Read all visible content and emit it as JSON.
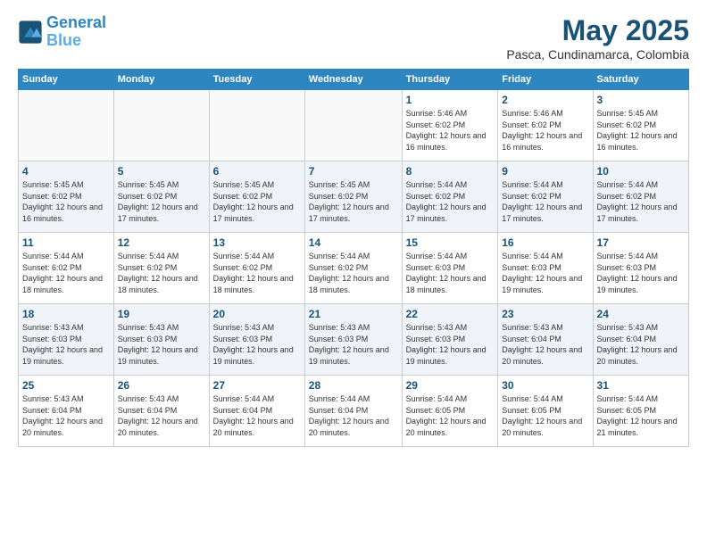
{
  "header": {
    "logo_line1": "General",
    "logo_line2": "Blue",
    "month_title": "May 2025",
    "location": "Pasca, Cundinamarca, Colombia"
  },
  "weekdays": [
    "Sunday",
    "Monday",
    "Tuesday",
    "Wednesday",
    "Thursday",
    "Friday",
    "Saturday"
  ],
  "weeks": [
    [
      {
        "day": "",
        "info": ""
      },
      {
        "day": "",
        "info": ""
      },
      {
        "day": "",
        "info": ""
      },
      {
        "day": "",
        "info": ""
      },
      {
        "day": "1",
        "info": "Sunrise: 5:46 AM\nSunset: 6:02 PM\nDaylight: 12 hours\nand 16 minutes."
      },
      {
        "day": "2",
        "info": "Sunrise: 5:46 AM\nSunset: 6:02 PM\nDaylight: 12 hours\nand 16 minutes."
      },
      {
        "day": "3",
        "info": "Sunrise: 5:45 AM\nSunset: 6:02 PM\nDaylight: 12 hours\nand 16 minutes."
      }
    ],
    [
      {
        "day": "4",
        "info": "Sunrise: 5:45 AM\nSunset: 6:02 PM\nDaylight: 12 hours\nand 16 minutes."
      },
      {
        "day": "5",
        "info": "Sunrise: 5:45 AM\nSunset: 6:02 PM\nDaylight: 12 hours\nand 17 minutes."
      },
      {
        "day": "6",
        "info": "Sunrise: 5:45 AM\nSunset: 6:02 PM\nDaylight: 12 hours\nand 17 minutes."
      },
      {
        "day": "7",
        "info": "Sunrise: 5:45 AM\nSunset: 6:02 PM\nDaylight: 12 hours\nand 17 minutes."
      },
      {
        "day": "8",
        "info": "Sunrise: 5:44 AM\nSunset: 6:02 PM\nDaylight: 12 hours\nand 17 minutes."
      },
      {
        "day": "9",
        "info": "Sunrise: 5:44 AM\nSunset: 6:02 PM\nDaylight: 12 hours\nand 17 minutes."
      },
      {
        "day": "10",
        "info": "Sunrise: 5:44 AM\nSunset: 6:02 PM\nDaylight: 12 hours\nand 17 minutes."
      }
    ],
    [
      {
        "day": "11",
        "info": "Sunrise: 5:44 AM\nSunset: 6:02 PM\nDaylight: 12 hours\nand 18 minutes."
      },
      {
        "day": "12",
        "info": "Sunrise: 5:44 AM\nSunset: 6:02 PM\nDaylight: 12 hours\nand 18 minutes."
      },
      {
        "day": "13",
        "info": "Sunrise: 5:44 AM\nSunset: 6:02 PM\nDaylight: 12 hours\nand 18 minutes."
      },
      {
        "day": "14",
        "info": "Sunrise: 5:44 AM\nSunset: 6:02 PM\nDaylight: 12 hours\nand 18 minutes."
      },
      {
        "day": "15",
        "info": "Sunrise: 5:44 AM\nSunset: 6:03 PM\nDaylight: 12 hours\nand 18 minutes."
      },
      {
        "day": "16",
        "info": "Sunrise: 5:44 AM\nSunset: 6:03 PM\nDaylight: 12 hours\nand 19 minutes."
      },
      {
        "day": "17",
        "info": "Sunrise: 5:44 AM\nSunset: 6:03 PM\nDaylight: 12 hours\nand 19 minutes."
      }
    ],
    [
      {
        "day": "18",
        "info": "Sunrise: 5:43 AM\nSunset: 6:03 PM\nDaylight: 12 hours\nand 19 minutes."
      },
      {
        "day": "19",
        "info": "Sunrise: 5:43 AM\nSunset: 6:03 PM\nDaylight: 12 hours\nand 19 minutes."
      },
      {
        "day": "20",
        "info": "Sunrise: 5:43 AM\nSunset: 6:03 PM\nDaylight: 12 hours\nand 19 minutes."
      },
      {
        "day": "21",
        "info": "Sunrise: 5:43 AM\nSunset: 6:03 PM\nDaylight: 12 hours\nand 19 minutes."
      },
      {
        "day": "22",
        "info": "Sunrise: 5:43 AM\nSunset: 6:03 PM\nDaylight: 12 hours\nand 19 minutes."
      },
      {
        "day": "23",
        "info": "Sunrise: 5:43 AM\nSunset: 6:04 PM\nDaylight: 12 hours\nand 20 minutes."
      },
      {
        "day": "24",
        "info": "Sunrise: 5:43 AM\nSunset: 6:04 PM\nDaylight: 12 hours\nand 20 minutes."
      }
    ],
    [
      {
        "day": "25",
        "info": "Sunrise: 5:43 AM\nSunset: 6:04 PM\nDaylight: 12 hours\nand 20 minutes."
      },
      {
        "day": "26",
        "info": "Sunrise: 5:43 AM\nSunset: 6:04 PM\nDaylight: 12 hours\nand 20 minutes."
      },
      {
        "day": "27",
        "info": "Sunrise: 5:44 AM\nSunset: 6:04 PM\nDaylight: 12 hours\nand 20 minutes."
      },
      {
        "day": "28",
        "info": "Sunrise: 5:44 AM\nSunset: 6:04 PM\nDaylight: 12 hours\nand 20 minutes."
      },
      {
        "day": "29",
        "info": "Sunrise: 5:44 AM\nSunset: 6:05 PM\nDaylight: 12 hours\nand 20 minutes."
      },
      {
        "day": "30",
        "info": "Sunrise: 5:44 AM\nSunset: 6:05 PM\nDaylight: 12 hours\nand 20 minutes."
      },
      {
        "day": "31",
        "info": "Sunrise: 5:44 AM\nSunset: 6:05 PM\nDaylight: 12 hours\nand 21 minutes."
      }
    ]
  ]
}
